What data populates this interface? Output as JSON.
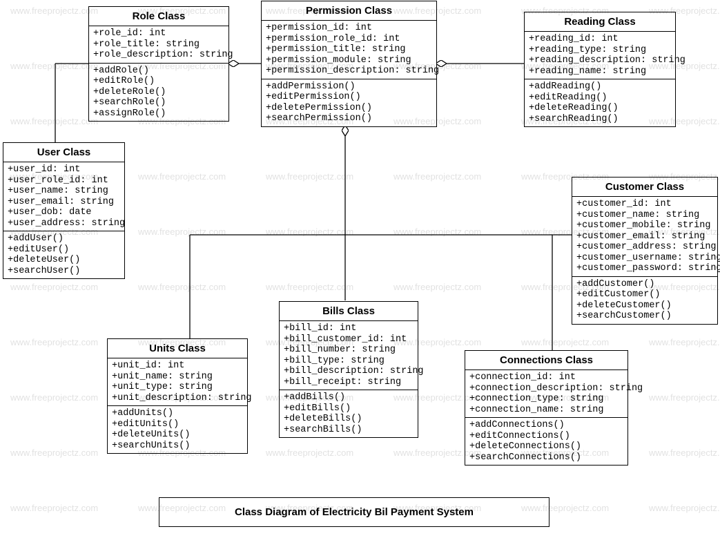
{
  "watermark": "www.freeprojectz.com",
  "caption": "Class Diagram of Electricity Bil Payment System",
  "classes": {
    "role": {
      "title": "Role Class",
      "attrs": [
        "+role_id: int",
        "+role_title: string",
        "+role_description: string"
      ],
      "methods": [
        "+addRole()",
        "+editRole()",
        "+deleteRole()",
        "+searchRole()",
        "+assignRole()"
      ]
    },
    "permission": {
      "title": "Permission Class",
      "attrs": [
        "+permission_id: int",
        "+permission_role_id: int",
        "+permission_title: string",
        "+permission_module: string",
        "+permission_description: string"
      ],
      "methods": [
        "+addPermission()",
        "+editPermission()",
        "+deletePermission()",
        "+searchPermission()"
      ]
    },
    "reading": {
      "title": "Reading Class",
      "attrs": [
        "+reading_id: int",
        "+reading_type: string",
        "+reading_description: string",
        "+reading_name: string"
      ],
      "methods": [
        "+addReading()",
        "+editReading()",
        "+deleteReading()",
        "+searchReading()"
      ]
    },
    "user": {
      "title": "User Class",
      "attrs": [
        "+user_id: int",
        "+user_role_id: int",
        "+user_name: string",
        "+user_email: string",
        "+user_dob: date",
        "+user_address: string"
      ],
      "methods": [
        "+addUser()",
        "+editUser()",
        "+deleteUser()",
        "+searchUser()"
      ]
    },
    "customer": {
      "title": "Customer Class",
      "attrs": [
        "+customer_id: int",
        "+customer_name: string",
        "+customer_mobile: string",
        "+customer_email: string",
        "+customer_address: string",
        "+customer_username: string",
        "+customer_password: string"
      ],
      "methods": [
        "+addCustomer()",
        "+editCustomer()",
        "+deleteCustomer()",
        "+searchCustomer()"
      ]
    },
    "bills": {
      "title": "Bills Class",
      "attrs": [
        "+bill_id: int",
        "+bill_customer_id: int",
        "+bill_number: string",
        "+bill_type: string",
        "+bill_description: string",
        "+bill_receipt: string"
      ],
      "methods": [
        "+addBills()",
        "+editBills()",
        "+deleteBills()",
        "+searchBills()"
      ]
    },
    "units": {
      "title": "Units Class",
      "attrs": [
        "+unit_id: int",
        "+unit_name: string",
        "+unit_type: string",
        "+unit_description: string"
      ],
      "methods": [
        "+addUnits()",
        "+editUnits()",
        "+deleteUnits()",
        "+searchUnits()"
      ]
    },
    "connections": {
      "title": "Connections Class",
      "attrs": [
        "+connection_id: int",
        "+connection_description: string",
        "+connection_type: string",
        "+connection_name: string"
      ],
      "methods": [
        "+addConnections()",
        "+editConnections()",
        "+deleteConnections()",
        "+searchConnections()"
      ]
    }
  }
}
